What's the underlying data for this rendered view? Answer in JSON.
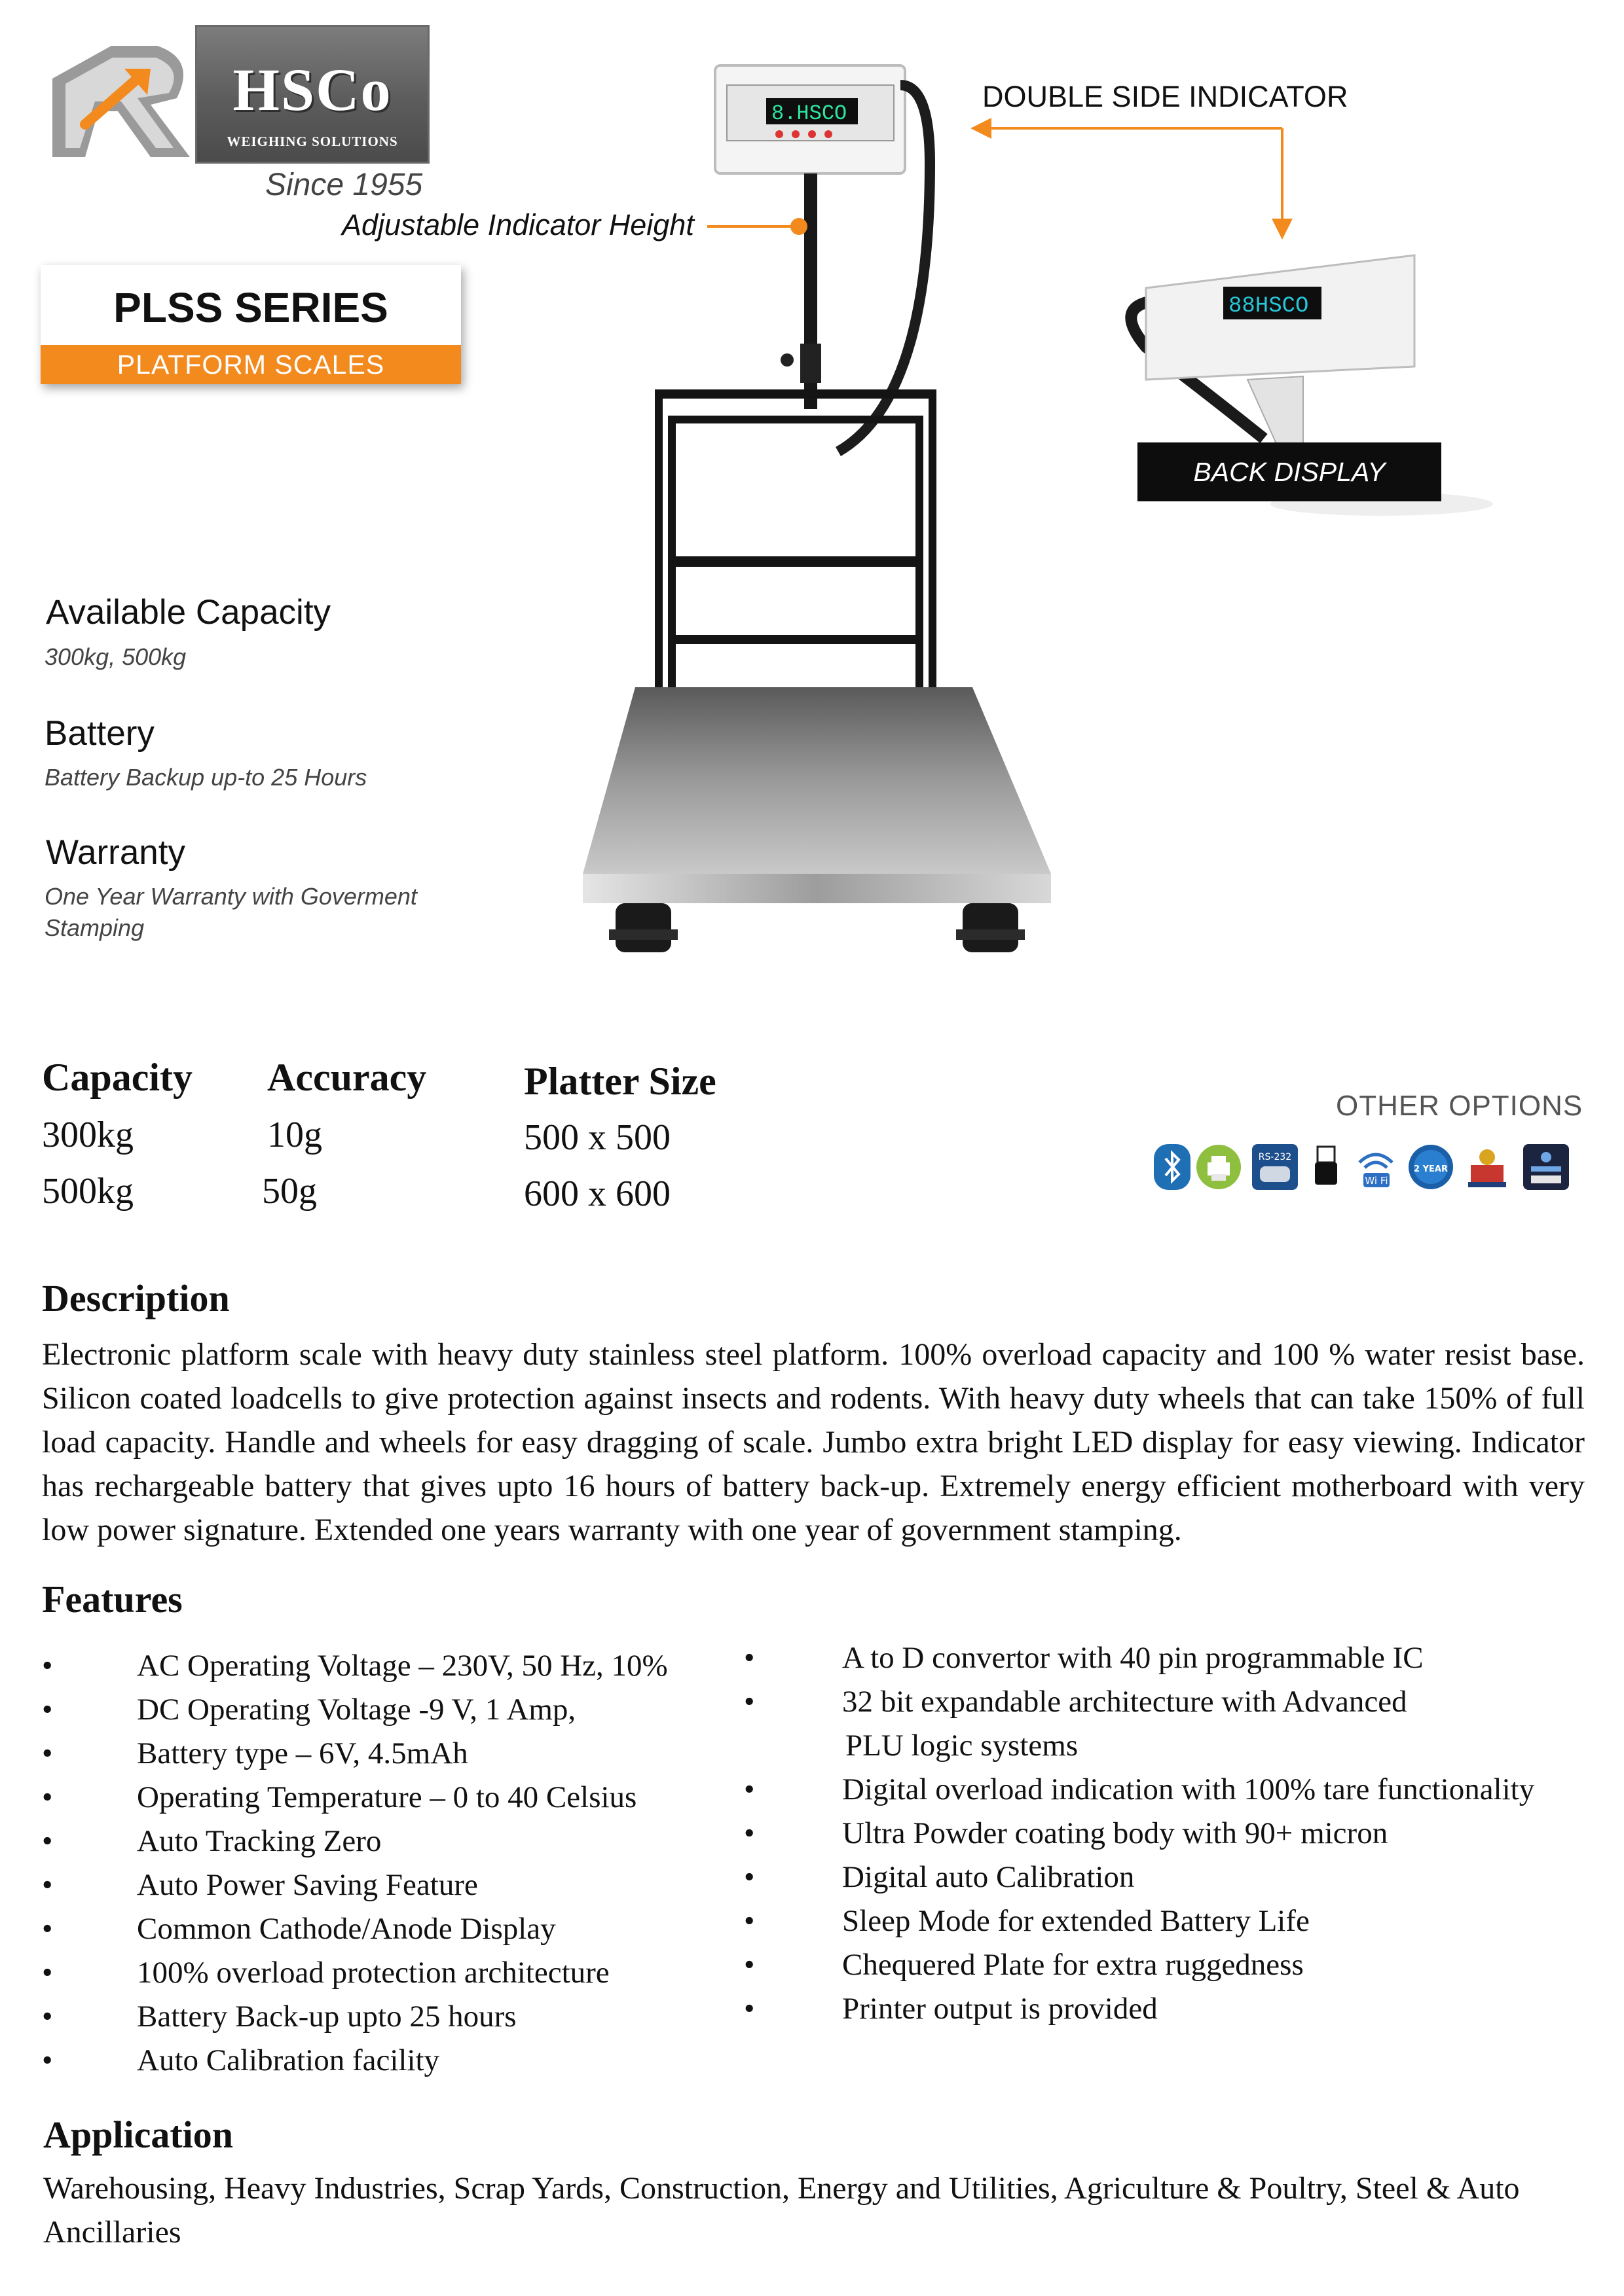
{
  "logo": {
    "name": "HSCo",
    "tagline": "WEIGHING SOLUTIONS",
    "since": "Since 1955"
  },
  "series": {
    "title": "PLSS SERIES",
    "subtitle": "PLATFORM SCALES"
  },
  "callouts": {
    "adjustable": "Adjustable Indicator Height",
    "double_side": "DOUBLE SIDE INDICATOR",
    "back_display": "BACK DISPLAY",
    "display_text": "HSCO"
  },
  "specs": [
    {
      "label": "Available Capacity",
      "value": "300kg, 500kg"
    },
    {
      "label": "Battery",
      "value": "Battery Backup up-to 25 Hours"
    },
    {
      "label": "Warranty",
      "value": "One Year Warranty with Goverment Stamping"
    }
  ],
  "table": {
    "headers": [
      "Capacity",
      "Accuracy",
      "Platter Size"
    ],
    "rows": [
      [
        "300kg",
        "10g",
        "500 x 500"
      ],
      [
        "500kg",
        "50g",
        "600 x 600"
      ]
    ]
  },
  "other_options": {
    "title": "OTHER OPTIONS",
    "icons": [
      "bluetooth-icon",
      "printer-icon",
      "rs232-icon",
      "usb-icon",
      "wifi-icon",
      "warranty-2-year-icon",
      "government-stamp-icon",
      "display-icon"
    ],
    "rs232_label": "RS-232",
    "wifi_label": "Wi Fi",
    "warranty_label": "2 YEAR"
  },
  "description": {
    "heading": "Description",
    "text": "Electronic platform scale with heavy duty stainless steel platform. 100% overload capacity and 100 % water resist base. Silicon coated loadcells to give protection against insects and rodents. With heavy duty wheels that can take 150% of full load capacity. Handle and wheels for easy dragging of scale. Jumbo extra bright LED display for easy viewing. Indicator has rechargeable battery that gives upto 16 hours of battery back-up. Extremely energy efficient motherboard with very low power signature. Extended one years warranty with one year of government stamping."
  },
  "features": {
    "heading": "Features",
    "bullet": "•",
    "left": [
      "AC Operating Voltage – 230V, 50 Hz, 10%",
      "DC Operating Voltage -9 V, 1 Amp,",
      "Battery type – 6V, 4.5mAh",
      "Operating Temperature – 0 to 40 Celsius",
      "Auto Tracking Zero",
      "Auto Power Saving Feature",
      "Common Cathode/Anode Display",
      "100% overload protection architecture",
      "Battery Back-up upto 25 hours",
      "Auto Calibration facility"
    ],
    "right": [
      "A to D convertor with 40 pin programmable IC",
      "32 bit expandable architecture with Advanced",
      "PLU logic systems",
      "Digital overload indication with 100% tare functionality",
      "Ultra Powder coating body with 90+ micron",
      "Digital auto Calibration",
      "Sleep Mode for extended Battery Life",
      "Chequered Plate for extra ruggedness",
      "Printer output is provided"
    ]
  },
  "application": {
    "heading": "Application",
    "text": "Warehousing, Heavy Industries, Scrap Yards, Construction, Energy and Utilities, Agriculture & Poultry, Steel & Auto Ancillaries"
  },
  "colors": {
    "accent": "#f28a1e",
    "dark": "#0d0d0d",
    "steel": "#a9a9a9"
  }
}
